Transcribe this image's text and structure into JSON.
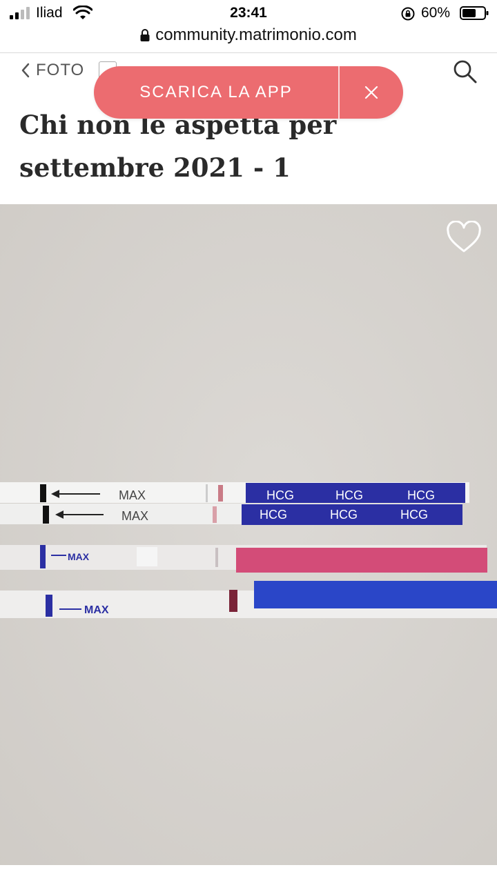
{
  "status_bar": {
    "carrier": "Iliad",
    "time": "23:41",
    "battery_percent": "60%"
  },
  "browser": {
    "url": "community.matrimonio.com"
  },
  "header": {
    "back_label": "FOTO"
  },
  "banner": {
    "cta_label": "SCARICA LA APP",
    "close_symbol": "×"
  },
  "page": {
    "title": "Chi non le aspetta per settembre 2021 - 1"
  },
  "photo": {
    "strips": [
      {
        "max_label": "MAX",
        "brand_label": "HCG"
      },
      {
        "max_label": "MAX",
        "brand_label": "HCG"
      },
      {
        "max_label": "MAX"
      },
      {
        "max_label": "MAX"
      }
    ]
  },
  "icons": {
    "back": "chevron-left-icon",
    "search": "search-icon",
    "favorite": "heart-icon",
    "close": "close-icon"
  },
  "colors": {
    "banner": "#ec6c70",
    "strip_blue": "#2b2fa3",
    "strip_pink": "#cc2f62",
    "strip_royal": "#2a46c8"
  }
}
